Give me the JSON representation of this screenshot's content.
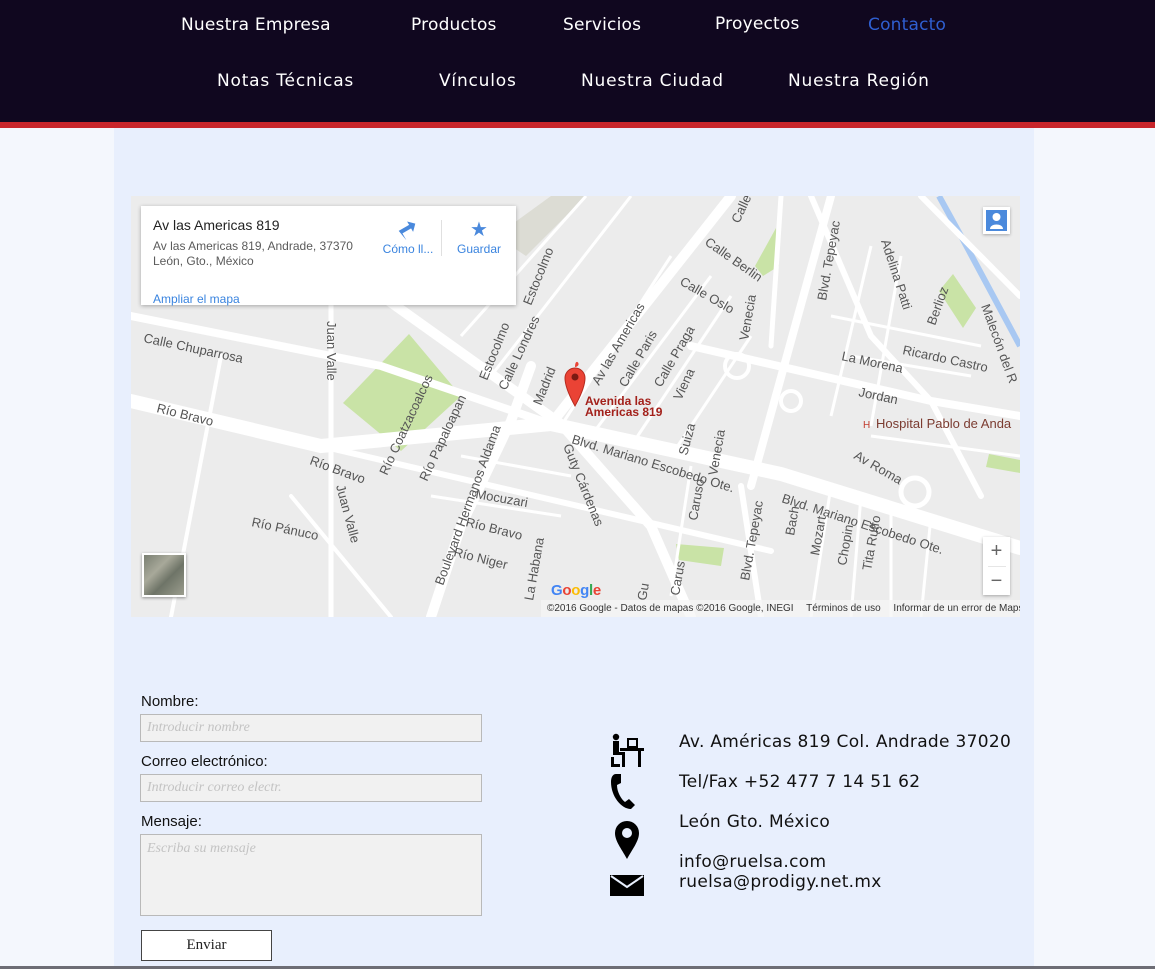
{
  "nav": {
    "row1": [
      {
        "label": "Nuestra Empresa",
        "active": false
      },
      {
        "label": "Productos",
        "active": false
      },
      {
        "label": "Servicios",
        "active": false
      },
      {
        "label": "Proyectos",
        "active": false
      },
      {
        "label": "Contacto",
        "active": true
      }
    ],
    "row2": [
      {
        "label": "Notas Técnicas"
      },
      {
        "label": "Vínculos"
      },
      {
        "label": "Nuestra Ciudad"
      },
      {
        "label": "Nuestra Región"
      }
    ]
  },
  "map": {
    "card": {
      "title": "Av las Americas 819",
      "address_line1": "Av las Americas 819, Andrade, 37370",
      "address_line2": "León, Gto., México",
      "directions_label": "Cómo ll...",
      "save_label": "Guardar",
      "enlarge_label": "Ampliar el mapa"
    },
    "marker_label_line1": "Avenida las",
    "marker_label_line2": "Americas 819",
    "poi_hospital": "Hospital Pablo de Anda",
    "streets": [
      "Calle Chuparrosa",
      "Río Bravo",
      "Río Bravo",
      "Río Pánuco",
      "Río Niger",
      "Juan Valle",
      "Juan Valle",
      "Río Coatzacoalcos",
      "Río Papaloapan",
      "Boulevard Hermanos Aldama",
      "Mocuzari",
      "Río Bravo",
      "Estocolmo",
      "Estocolmo",
      "Calle Londres",
      "Madrid",
      "Av las Americas",
      "Calle Paris",
      "Calle Praga",
      "Calle Oslo",
      "Calle Berlin",
      "Calle",
      "Viena",
      "Venecia",
      "Blvd. Tepeyac",
      "Adelina Patti",
      "Berlioz",
      "Malecón del R",
      "Ricardo Castro",
      "La Morena",
      "Jordan",
      "Av Roma",
      "Blvd. Mariano Escobedo Ote.",
      "Blvd. Mariano Escobedo Ote.",
      "Guty Cárdenas",
      "Suiza",
      "Venecia",
      "Caruso",
      "Blvd. Tepeyac",
      "Bach",
      "Mozart",
      "Chopin",
      "Tita Ruffo",
      "La Habana",
      "Carus",
      "Gu"
    ],
    "zoom_in": "+",
    "zoom_out": "−",
    "google_logo": "Google",
    "footer_copyright": "©2016 Google - Datos de mapas ©2016 Google, INEGI",
    "footer_terms": "Términos de uso",
    "footer_report": "Informar de un error de Maps"
  },
  "form": {
    "name_label": "Nombre:",
    "name_placeholder": "Introducir nombre",
    "email_label": "Correo electrónico:",
    "email_placeholder": "Introducir correo electr.",
    "message_label": "Mensaje:",
    "message_placeholder": "Escriba su mensaje",
    "submit_label": "Enviar"
  },
  "contact": {
    "address": "Av. Américas 819 Col. Andrade 37020",
    "phone": "Tel/Fax +52 477 7 14 51 62",
    "city": "León Gto. México",
    "email1": "info@ruelsa.com",
    "email2": "ruelsa@prodigy.net.mx"
  },
  "colors": {
    "header_bg": "#10071f",
    "header_stripe": "#c8252b",
    "nav_active": "#2f5fd1",
    "panel_bg": "#e8effd",
    "map_marker": "#ea4335",
    "map_park": "#c9e3a6"
  }
}
